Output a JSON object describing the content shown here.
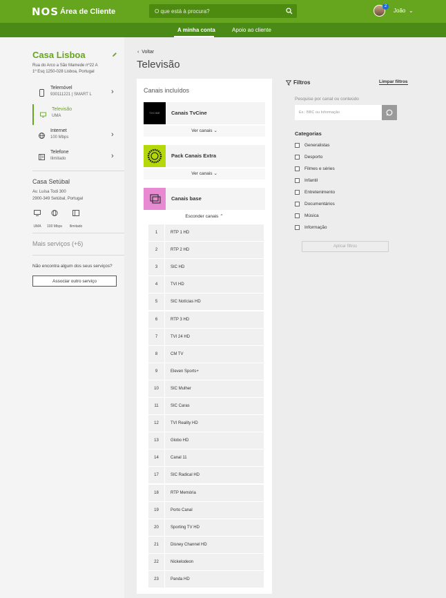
{
  "header": {
    "logo": "NOS",
    "app_title": "Área de Cliente",
    "search_placeholder": "O que está à procura?",
    "notification_count": "2",
    "user_name": "João",
    "colors": {
      "primary": "#66a51e",
      "dark": "#4a8a17"
    }
  },
  "subnav": {
    "tabs": [
      {
        "label": "A minha conta",
        "active": true
      },
      {
        "label": "Apoio ao cliente",
        "active": false
      }
    ]
  },
  "sidebar": {
    "home_title": "Casa Lisboa",
    "address_line1": "Rua do Arco a São Mamede nº22 A",
    "address_line2": "1º Esq 1250-028 Lisboa, Portugal",
    "services": [
      {
        "name": "Telemóvel",
        "detail": "930111221 | SMART L",
        "icon": "mobile-icon",
        "active": false
      },
      {
        "name": "Televisão",
        "detail": "UMA",
        "icon": "tv-icon",
        "active": true
      },
      {
        "name": "Internet",
        "detail": "100 Mbps",
        "icon": "globe-icon",
        "active": false
      },
      {
        "name": "Telefone",
        "detail": "Ilimitado",
        "icon": "phone-icon",
        "active": false
      }
    ],
    "second_home": {
      "title": "Casa Setúbal",
      "address_line1": "Av. Luísa Todi 300",
      "address_line2": "2900-349 Setúbal, Portugal",
      "mini_services": [
        {
          "label": "UMA",
          "icon": "tv-icon"
        },
        {
          "label": "100 Mbps",
          "icon": "globe-icon"
        },
        {
          "label": "Ilimitado",
          "icon": "phone-icon"
        }
      ]
    },
    "more_services": "Mais serviços (+6)",
    "help_text": "Não encontra algum dos seus serviços?",
    "associate_button": "Associar outro serviço"
  },
  "main": {
    "back_label": "Voltar",
    "page_title": "Televisão",
    "card_title": "Canais incluídos",
    "packages": [
      {
        "name": "Canais TvCine",
        "toggle": "Ver canais",
        "thumb_color": "#000000",
        "thumb_text": "TVCINE"
      },
      {
        "name": "Pack Canais Extra",
        "toggle": "Ver canais",
        "thumb_color": "#b5d80a"
      },
      {
        "name": "Canais base",
        "toggle": "Esconder canais",
        "thumb_color": "#e78ad2"
      }
    ],
    "channels": [
      {
        "num": "1",
        "name": "RTP 1 HD"
      },
      {
        "num": "2",
        "name": "RTP 2 HD"
      },
      {
        "num": "3",
        "name": "SIC HD"
      },
      {
        "num": "4",
        "name": "TVI HD"
      },
      {
        "num": "5",
        "name": "SIC Notícias HD"
      },
      {
        "num": "6",
        "name": "RTP 3 HD"
      },
      {
        "num": "7",
        "name": "TVI 24 HD"
      },
      {
        "num": "8",
        "name": "CM TV"
      },
      {
        "num": "9",
        "name": "Eleven Sports+"
      },
      {
        "num": "10",
        "name": "SIC Mulher"
      },
      {
        "num": "11",
        "name": "SIC Caras"
      },
      {
        "num": "12",
        "name": "TVI Reality HD"
      },
      {
        "num": "13",
        "name": "Globo HD"
      },
      {
        "num": "14",
        "name": "Canal 11"
      },
      {
        "num": "17",
        "name": "SIC Radical HD"
      },
      {
        "num": "18",
        "name": "RTP Memória"
      },
      {
        "num": "19",
        "name": "Porto Canal"
      },
      {
        "num": "20",
        "name": "Sporting TV HD"
      },
      {
        "num": "21",
        "name": "Disney Channel HD"
      },
      {
        "num": "22",
        "name": "Nickelodeon"
      },
      {
        "num": "23",
        "name": "Panda HD"
      }
    ]
  },
  "filters": {
    "title": "Filtros",
    "clear_label": "Limpar filtros",
    "search_label": "Pesquise por canal ou conteúdo",
    "search_placeholder": "Ex.: BBC ou Informação",
    "categories_title": "Categorias",
    "categories": [
      "Generalistas",
      "Desporto",
      "Filmes e séries",
      "Infantil",
      "Entretenimento",
      "Documentários",
      "Música",
      "Informação"
    ],
    "apply_label": "Aplicar filtros"
  }
}
